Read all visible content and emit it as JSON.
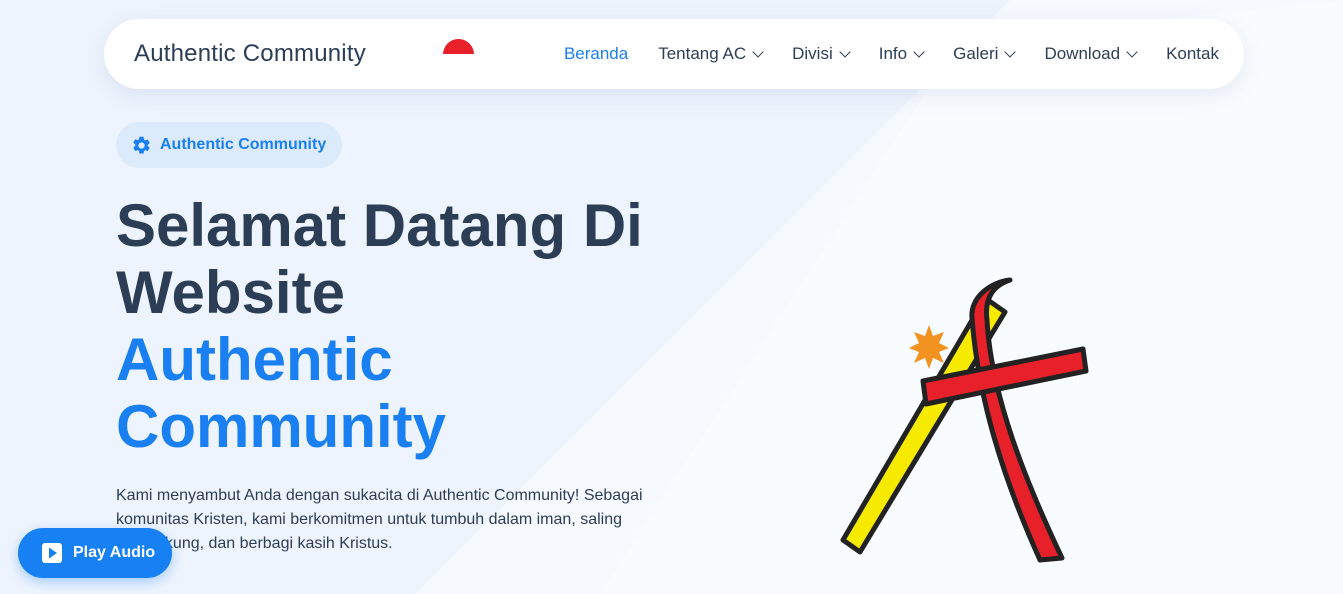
{
  "navbar": {
    "brand": "Authentic Community",
    "menu": [
      {
        "label": "Beranda",
        "active": true,
        "dropdown": false
      },
      {
        "label": "Tentang AC",
        "active": false,
        "dropdown": true
      },
      {
        "label": "Divisi",
        "active": false,
        "dropdown": true
      },
      {
        "label": "Info",
        "active": false,
        "dropdown": true
      },
      {
        "label": "Galeri",
        "active": false,
        "dropdown": true
      },
      {
        "label": "Download",
        "active": false,
        "dropdown": true
      },
      {
        "label": "Kontak",
        "active": false,
        "dropdown": false
      }
    ]
  },
  "hero": {
    "badge": "Authentic Community",
    "title_line1": "Selamat Datang Di",
    "title_line2": "Website",
    "title_accent_line1": "Authentic",
    "title_accent_line2": "Community",
    "description": "Kami menyambut Anda dengan sukacita di Authentic Community! Sebagai komunitas Kristen, kami berkomitmen untuk tumbuh dalam iman, saling mendukung, dan berbagi kasih Kristus."
  },
  "audio": {
    "label": "Play Audio"
  },
  "icons": {
    "badge": "gear-icon",
    "audio": "play-icon",
    "flag": "indonesia-flag-icon",
    "logo": "authentic-community-logo"
  },
  "colors": {
    "accent": "#1a7ff0",
    "text": "#2b3e56",
    "flag_red": "#e8202a",
    "logo_yellow": "#f5ea00",
    "logo_red": "#e8202a",
    "logo_star": "#f29221"
  }
}
